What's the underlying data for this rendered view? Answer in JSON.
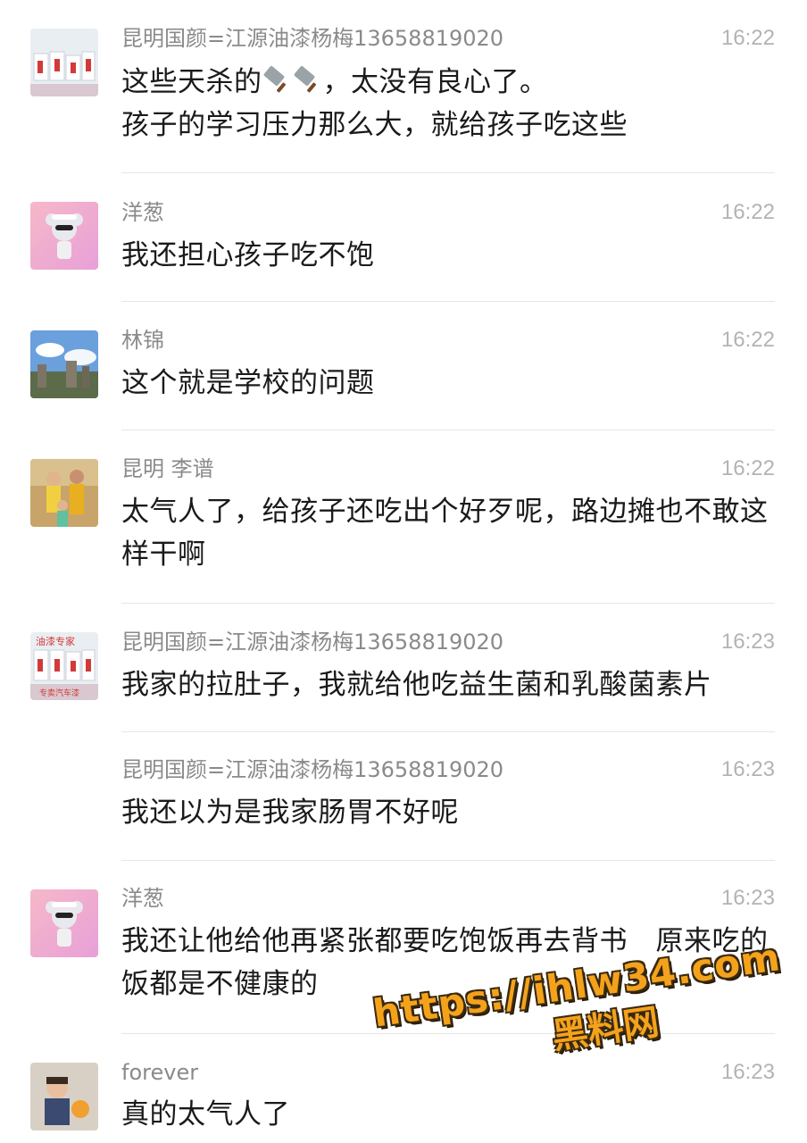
{
  "messages": [
    {
      "sender": "昆明国颜=江源油漆杨梅13658819020",
      "time": "16:22",
      "text_a": "这些天杀的",
      "text_b": "，太没有良心了。",
      "text_line2": "孩子的学习压力那么大，就给孩子吃这些",
      "avatar": "paint-shop-avatar",
      "emoji": "cleaver-emoji"
    },
    {
      "sender": "洋葱",
      "time": "16:22",
      "text": "我还担心孩子吃不饱",
      "avatar": "cartoon-mouse-avatar"
    },
    {
      "sender": "林锦",
      "time": "16:22",
      "text": "这个就是学校的问题",
      "avatar": "landscape-avatar"
    },
    {
      "sender": "昆明 李谱",
      "time": "16:22",
      "text": "太气人了，给孩子还吃出个好歹呢，路边摊也不敢这样干啊",
      "avatar": "family-photo-avatar"
    },
    {
      "sender": "昆明国颜=江源油漆杨梅13658819020",
      "time": "16:23",
      "text": "我家的拉肚子，我就给他吃益生菌和乳酸菌素片",
      "avatar": "paint-shop-avatar",
      "avatar_text": {
        "top": "油漆专家",
        "bottom": "专卖汽车漆"
      }
    },
    {
      "sender": "昆明国颜=江源油漆杨梅13658819020",
      "time": "16:23",
      "text": "我还以为是我家肠胃不好呢"
    },
    {
      "sender": "洋葱",
      "time": "16:23",
      "text": "我还让他给他再紧张都要吃饱饭再去背书　原来吃的饭都是不健康的",
      "avatar": "cartoon-mouse-avatar"
    },
    {
      "sender": "forever",
      "time": "16:23",
      "text": "真的太气人了",
      "avatar": "child-photo-avatar"
    }
  ],
  "watermark": {
    "url": "https://ihlw34.com",
    "name": "黑料网"
  },
  "colors": {
    "sender": "#8a8a8a",
    "time": "#b3b3b3",
    "text": "#1a1a1a",
    "watermark": "#f5a21b"
  }
}
